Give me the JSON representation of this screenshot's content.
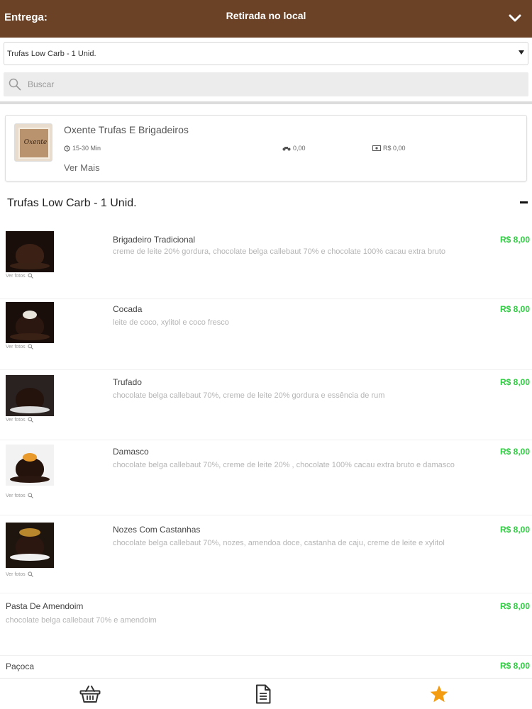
{
  "header": {
    "delivery_label": "Entrega:",
    "delivery_mode": "Retirada no local"
  },
  "category_select": {
    "value": "Trufas Low Carb - 1 Unid."
  },
  "search": {
    "placeholder": "Buscar"
  },
  "store": {
    "name": "Oxente Trufas E Brigadeiros",
    "logo_text": "Oxente",
    "time": "15-30 Min",
    "delivery_fee": "0,00",
    "min_order": "R$ 0,00",
    "see_more": "Ver Mais"
  },
  "category": {
    "title": "Trufas Low Carb - 1 Unid."
  },
  "products": [
    {
      "name": "Brigadeiro Tradicional",
      "description": "creme de leite 20% gordura, chocolate belga callebaut 70% e chocolate 100% cacau extra bruto",
      "price": "R$ 8,00",
      "photo_label": "Ver fotos"
    },
    {
      "name": "Cocada",
      "description": "leite de coco, xylitol e coco fresco",
      "price": "R$ 8,00",
      "photo_label": "Ver fotos"
    },
    {
      "name": "Trufado",
      "description": "chocolate belga callebaut 70%, creme de leite 20% gordura e essência de rum",
      "price": "R$ 8,00",
      "photo_label": "Ver fotos"
    },
    {
      "name": "Damasco",
      "description": "chocolate belga callebaut 70%, creme de leite 20% , chocolate 100% cacau extra bruto e damasco",
      "price": "R$ 8,00",
      "photo_label": "Ver fotos"
    },
    {
      "name": "Nozes Com Castanhas",
      "description": "chocolate belga callebaut 70%, nozes, amendoa doce, castanha de caju, creme de leite e xylitol",
      "price": "R$ 8,00",
      "photo_label": "Ver fotos"
    },
    {
      "name": "Pasta De Amendoim",
      "description": "chocolate belga callebaut 70% e amendoim",
      "price": "R$ 8,00"
    },
    {
      "name": "Paçoca",
      "description": "",
      "price": "R$ 8,00"
    }
  ],
  "colors": {
    "header_bg": "#6b4226",
    "price": "#2ecc40",
    "active_tab": "#f39c12"
  },
  "bottom_nav": {
    "icons": [
      "basket-icon",
      "document-icon",
      "star-icon"
    ]
  }
}
